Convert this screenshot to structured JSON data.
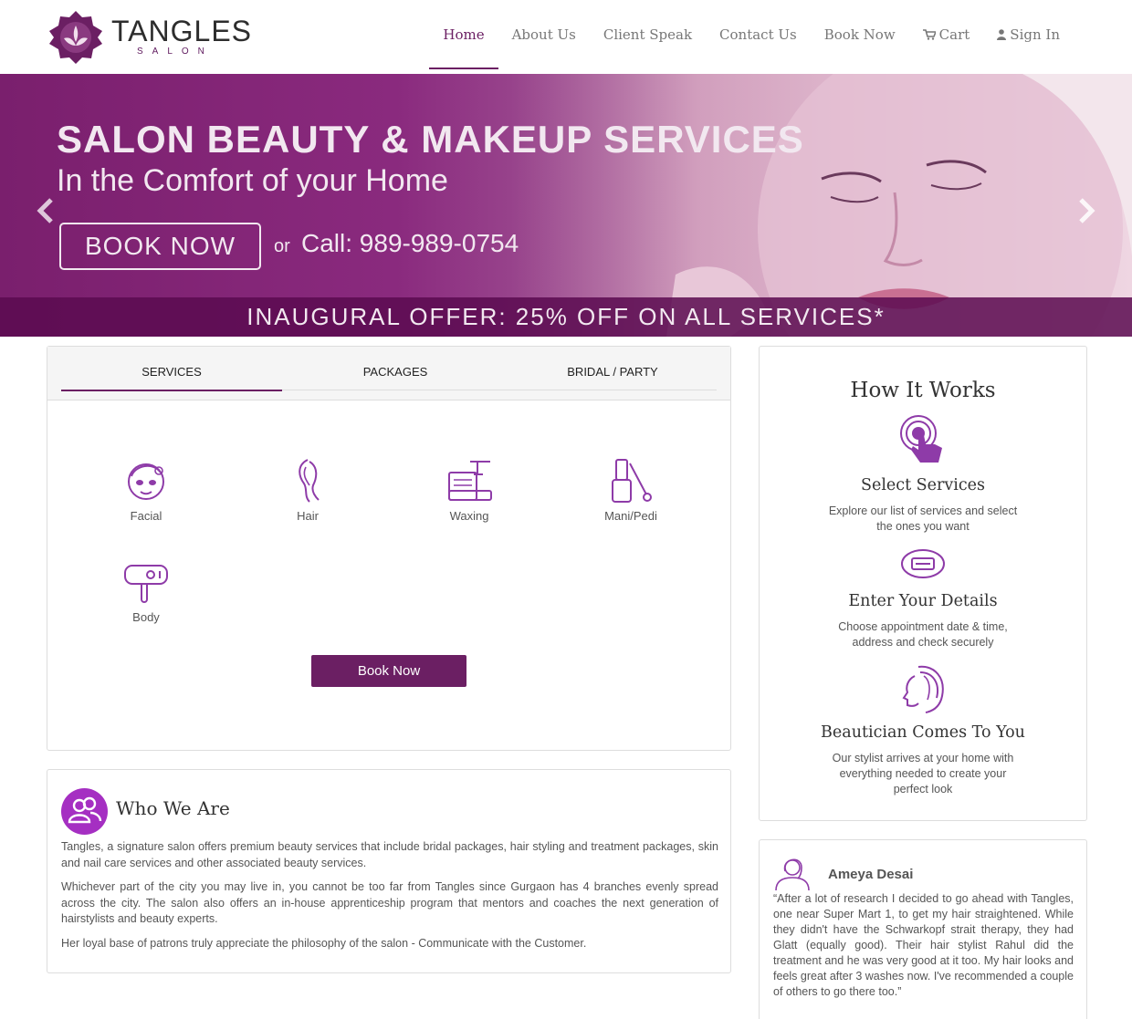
{
  "brand": {
    "name": "TANGLES",
    "sub": "SALON",
    "color": "#6b1f63"
  },
  "nav": {
    "items": [
      {
        "label": "Home",
        "active": true
      },
      {
        "label": "About Us"
      },
      {
        "label": "Client Speak"
      },
      {
        "label": "Contact Us"
      },
      {
        "label": "Book Now"
      },
      {
        "label": "Cart",
        "icon": "cart-icon"
      },
      {
        "label": "Sign In",
        "icon": "user-icon"
      }
    ]
  },
  "banner": {
    "headline": "SALON BEAUTY & MAKEUP SERVICES",
    "subheadline": "In the Comfort of your Home",
    "book_label": "BOOK NOW",
    "or": "or",
    "call": "Call: 989-989-0754",
    "offer": "INAUGURAL OFFER: 25% OFF ON ALL SERVICES*"
  },
  "tabs": {
    "items": [
      "SERVICES",
      "PACKAGES",
      "BRIDAL / PARTY"
    ],
    "active": "SERVICES"
  },
  "services": {
    "items": [
      {
        "label": "Facial",
        "icon": "facial-icon"
      },
      {
        "label": "Hair",
        "icon": "hair-icon"
      },
      {
        "label": "Waxing",
        "icon": "waxing-icon"
      },
      {
        "label": "Mani/Pedi",
        "icon": "nail-polish-icon"
      },
      {
        "label": "Body",
        "icon": "hair-dryer-icon"
      }
    ],
    "book_label": "Book Now"
  },
  "who": {
    "title": "Who We Are",
    "paragraphs": [
      "Tangles, a signature salon offers premium beauty services that include bridal packages, hair styling and treatment packages, skin and nail care services and other associated beauty services.",
      "Whichever part of the city you may live in, you cannot be too far from Tangles since Gurgaon has 4 branches evenly spread across the city. The salon also offers an in-house apprenticeship program that mentors and coaches the next generation of hairstylists and beauty experts.",
      "Her loyal base of patrons truly appreciate the philosophy of the salon - Communicate with the Customer."
    ]
  },
  "how": {
    "title": "How It Works",
    "steps": [
      {
        "title": "Select Services",
        "desc": "Explore our list of services and select the ones you want",
        "icon": "tap-icon"
      },
      {
        "title": "Enter Your Details",
        "desc": "Choose appointment date & time, address and check securely",
        "icon": "card-icon"
      },
      {
        "title": "Beautician Comes To You",
        "desc": "Our stylist arrives at your home with everything needed to create your perfect look",
        "icon": "woman-profile-icon"
      }
    ]
  },
  "testimonial": {
    "name": "Ameya Desai",
    "quote": "“After a lot of research I decided to go ahead with Tangles, one near Super Mart 1, to get my hair straightened. While they didn't have the Schwarkopf strait therapy, they had Glatt (equally good). Their hair stylist Rahul did the treatment and he was very good at it too. My hair looks and feels great after 3 washes now. I've recommended a couple of others to go there too.”"
  }
}
